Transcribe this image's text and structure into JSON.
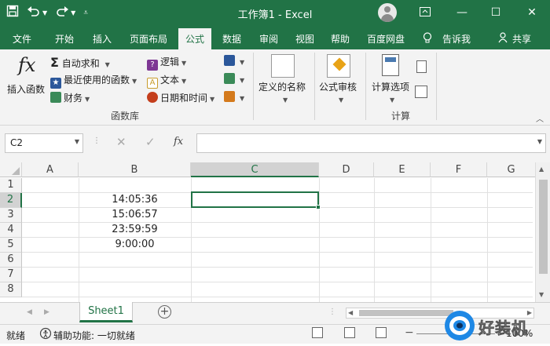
{
  "window": {
    "title": "工作簿1  -  Excel"
  },
  "tabs": [
    "文件",
    "开始",
    "插入",
    "页面布局",
    "公式",
    "数据",
    "审阅",
    "视图",
    "帮助",
    "百度网盘",
    "告诉我",
    "共享"
  ],
  "active_tab": "公式",
  "ribbon": {
    "insert_function": "插入函数",
    "autosum": "自动求和",
    "recent": "最近使用的函数",
    "financial": "财务",
    "logical": "逻辑",
    "text": "文本",
    "datetime": "日期和时间",
    "defined_names": "定义的名称",
    "formula_auditing": "公式审核",
    "calc_options": "计算选项",
    "group_function_library": "函数库",
    "group_calculation": "计算"
  },
  "formula_bar": {
    "name_box": "C2",
    "fx_label": "fx",
    "formula": ""
  },
  "columns": [
    "A",
    "B",
    "C",
    "D",
    "E",
    "F",
    "G"
  ],
  "selected_column": "C",
  "rows": [
    "1",
    "2",
    "3",
    "4",
    "5",
    "6",
    "7",
    "8"
  ],
  "selected_row": "2",
  "cells": {
    "B2": "14:05:36",
    "B3": "15:06:57",
    "B4": "23:59:59",
    "B5": "9:00:00"
  },
  "sheet_tab": "Sheet1",
  "status": {
    "ready": "就绪",
    "accessibility": "辅助功能: 一切就绪",
    "zoom": "100%"
  },
  "watermark_text": "好装机",
  "colors": {
    "excel_green": "#217346",
    "ribbon_bg": "#f3f3f3"
  }
}
